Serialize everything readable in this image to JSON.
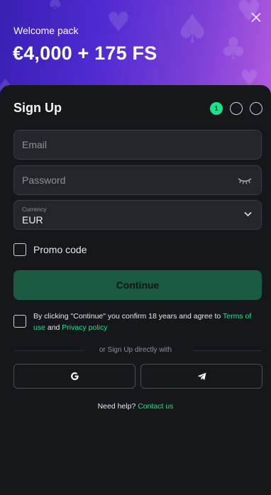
{
  "hero": {
    "subtitle": "Welcome pack",
    "headline": "€4,000 + 175 FS"
  },
  "signup": {
    "title": "Sign Up",
    "steps": [
      "1",
      "",
      ""
    ],
    "email_placeholder": "Email",
    "password_placeholder": "Password",
    "currency_label": "Currency",
    "currency_value": "EUR",
    "promo_label": "Promo code",
    "continue_label": "Continue",
    "terms_prefix": "By clicking \"Continue\" you confirm 18 years and agree to ",
    "terms_link": "Terms of use",
    "terms_and": " and ",
    "privacy_link": "Privacy policy",
    "divider_text": "or Sign Up directly with",
    "help_text": "Need help? ",
    "contact_link": "Contact us"
  },
  "icons": [
    "close-icon",
    "eye-closed-icon",
    "chevron-down-icon",
    "google-icon",
    "telegram-icon"
  ],
  "colors": {
    "accent": "#1fe08a",
    "link": "#22e08c",
    "button": "#1a5b42",
    "background": "#16171b",
    "field": "#24262c"
  }
}
